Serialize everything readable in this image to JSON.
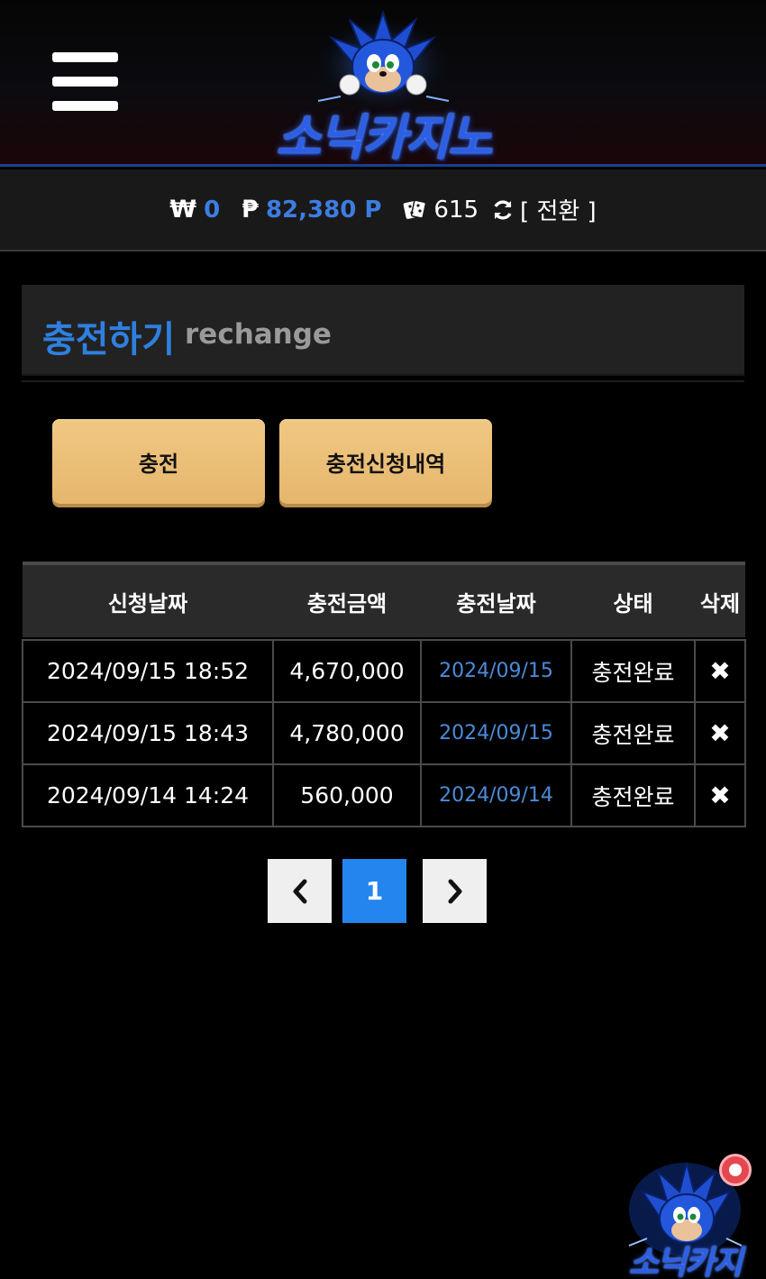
{
  "header": {
    "logo_text": "소닉카지노",
    "menu_icon": "hamburger-menu-icon"
  },
  "balance": {
    "won_symbol": "₩",
    "won_value": "0",
    "point_symbol": "₱",
    "point_value": "82,380 P",
    "chip_value": "615",
    "switch_label": "[ 전환 ]"
  },
  "section": {
    "title": "충전하기",
    "subtitle": "rechange"
  },
  "buttons": {
    "charge": "충전",
    "history": "충전신청내역"
  },
  "table": {
    "headers": [
      "신청날짜",
      "충전금액",
      "충전날짜",
      "상태",
      "삭제"
    ],
    "rows": [
      {
        "request_date": "2024/09/15 18:52",
        "amount": "4,670,000",
        "charge_date": "2024/09/15",
        "status": "충전완료",
        "delete": "✖"
      },
      {
        "request_date": "2024/09/15 18:43",
        "amount": "4,780,000",
        "charge_date": "2024/09/15",
        "status": "충전완료",
        "delete": "✖"
      },
      {
        "request_date": "2024/09/14 14:24",
        "amount": "560,000",
        "charge_date": "2024/09/14",
        "status": "충전완료",
        "delete": "✖"
      }
    ]
  },
  "pagination": {
    "current_page": "1"
  },
  "floating": {
    "text": "소닉카지"
  },
  "colors": {
    "accent_blue": "#2f7fe0",
    "button_gold": "#e6b66d",
    "page_active": "#2585ef"
  }
}
